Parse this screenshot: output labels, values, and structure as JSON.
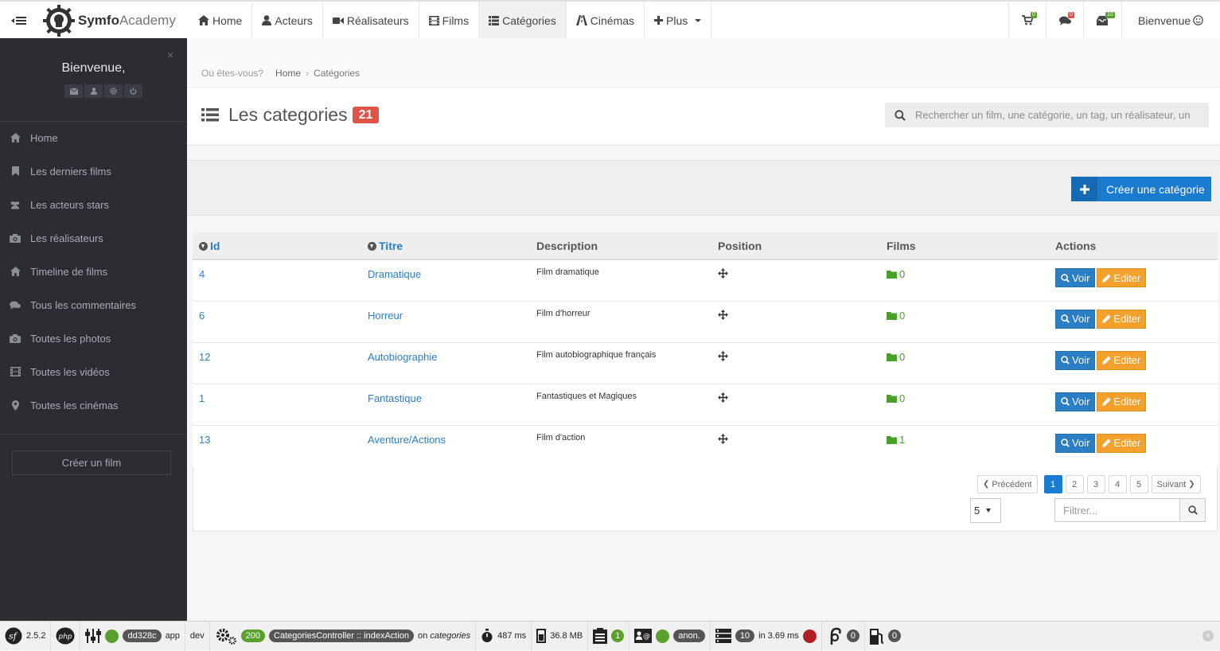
{
  "brand": {
    "name_bold": "Symfo",
    "name_light": "Academy"
  },
  "nav": [
    {
      "label": "Home",
      "icon": "home-icon"
    },
    {
      "label": "Acteurs",
      "icon": "user-icon"
    },
    {
      "label": "Réalisateurs",
      "icon": "video-camera-icon"
    },
    {
      "label": "Films",
      "icon": "film-icon"
    },
    {
      "label": "Catégories",
      "icon": "list-icon",
      "active": true
    },
    {
      "label": "Cinémas",
      "icon": "road-icon"
    },
    {
      "label": "Plus",
      "icon": "plus-icon"
    }
  ],
  "topright": {
    "cart_count": "0",
    "comments_count": "0",
    "messages_count": "10",
    "welcome": "Bienvenue"
  },
  "sidebar": {
    "welcome": "Bienvenue,",
    "items": [
      {
        "label": "Home",
        "icon": "home-icon"
      },
      {
        "label": "Les derniers films",
        "icon": "bookmark-icon"
      },
      {
        "label": "Les acteurs stars",
        "icon": "users-icon"
      },
      {
        "label": "Les réalisateurs",
        "icon": "camera-icon"
      },
      {
        "label": "Timeline de films",
        "icon": "home-icon"
      },
      {
        "label": "Tous les commentaires",
        "icon": "comments-icon"
      },
      {
        "label": "Toutes les photos",
        "icon": "camera-icon"
      },
      {
        "label": "Toutes les vidéos",
        "icon": "film-icon"
      },
      {
        "label": "Toutes les cinémas",
        "icon": "map-marker-icon"
      }
    ],
    "create_film": "Créer un film"
  },
  "breadcrumb": {
    "prefix": "Où êtes-vous?",
    "home": "Home",
    "current": "Catégories"
  },
  "page": {
    "title": "Les categories",
    "count": "21",
    "search_placeholder": "Rechercher un film, une catégorie, un tag, un réalisateur, un",
    "create_label": "Créer une catégorie"
  },
  "table": {
    "headers": {
      "id": "Id",
      "titre": "Titre",
      "description": "Description",
      "position": "Position",
      "films": "Films",
      "actions": "Actions"
    },
    "rows": [
      {
        "id": "4",
        "titre": "Dramatique",
        "description": "Film dramatique",
        "films": "0"
      },
      {
        "id": "6",
        "titre": "Horreur",
        "description": "Film d'horreur",
        "films": "0"
      },
      {
        "id": "12",
        "titre": "Autobiographie",
        "description": "Film autobiographique français",
        "films": "0"
      },
      {
        "id": "1",
        "titre": "Fantastique",
        "description": "Fantastiques et Magiques",
        "films": "0"
      },
      {
        "id": "13",
        "titre": "Aventure/Actions",
        "description": "Film d'action",
        "films": "1"
      }
    ],
    "voir_label": "Voir",
    "editer_label": "Editer"
  },
  "pagination": {
    "prev": "Précédent",
    "next": "Suivant",
    "pages": [
      "1",
      "2",
      "3",
      "4",
      "5"
    ],
    "current": "1",
    "page_size": "5",
    "filter_placeholder": "Filtrer..."
  },
  "debug": {
    "sf_version": "2.5.2",
    "token": "dd328c",
    "app": "app",
    "env": "dev",
    "status": "200",
    "controller": "CategoriesController",
    "action": "indexAction",
    "route_prefix": "on",
    "route": "categories",
    "time": "487 ms",
    "memory": "36.8 MB",
    "forms": "1",
    "user": "anon.",
    "queries": "10",
    "query_time": "in 3.69 ms",
    "twig": "0",
    "mail": "0"
  },
  "colors": {
    "primary": "#1a7ccf",
    "warning": "#f3a02d",
    "danger": "#e25347",
    "sidebar": "#2b2d33",
    "success": "#5aa02c"
  }
}
